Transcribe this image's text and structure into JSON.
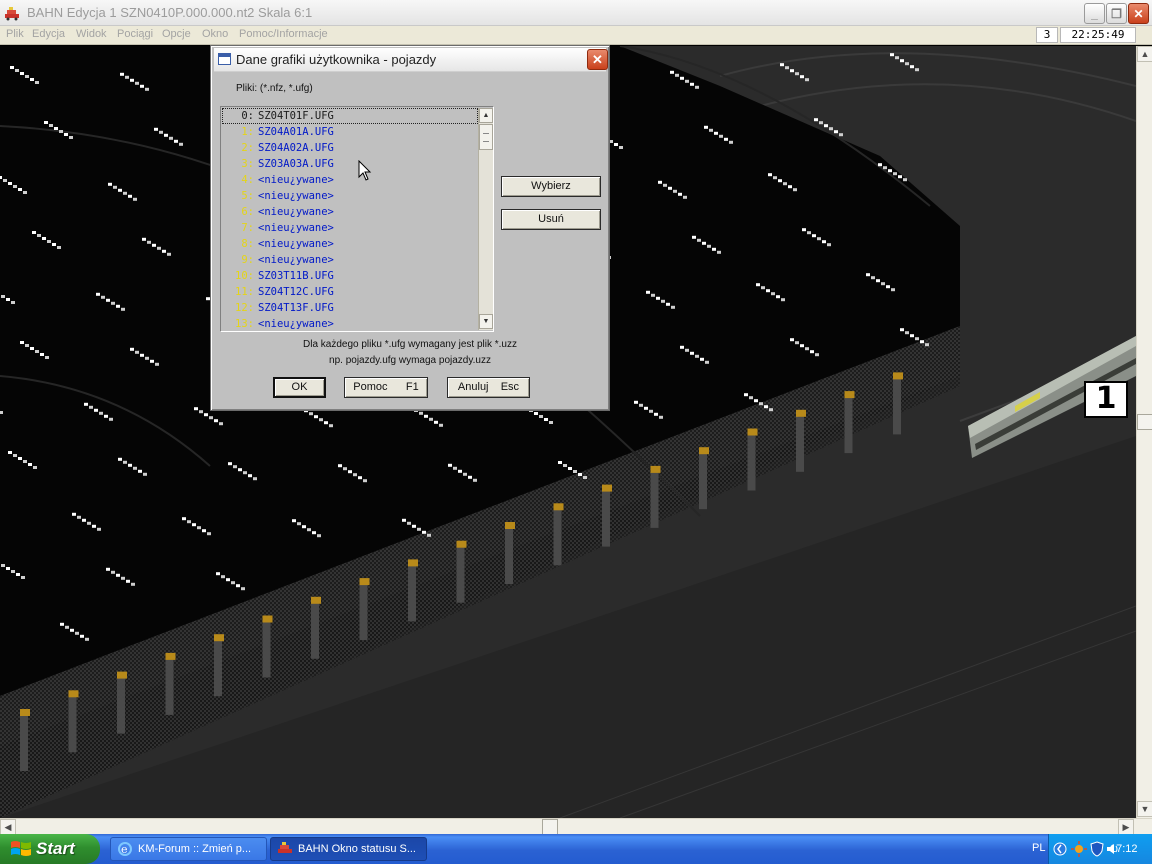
{
  "window": {
    "title": "BAHN Edycja 1 SZN0410P.000.000.nt2 Skala 6:1",
    "minimize_glyph": "_",
    "maximize_glyph": "❐",
    "close_glyph": "✕"
  },
  "menu": {
    "items": [
      "Plik",
      "Edycja",
      "Widok",
      "Pociągi",
      "Opcje",
      "Okno",
      "Pomoc/Informacje"
    ]
  },
  "status": {
    "count": "3",
    "time": "22:25:49"
  },
  "dialog": {
    "title": "Dane grafiki użytkownika - pojazdy",
    "close_glyph": "✕",
    "files_label": "Pliki: (*.nfz, *.ufg)",
    "rows": [
      {
        "index": "0:",
        "name": "SZ04T01F.UFG"
      },
      {
        "index": "1:",
        "name": "SZ04A01A.UFG"
      },
      {
        "index": "2:",
        "name": "SZ04A02A.UFG"
      },
      {
        "index": "3:",
        "name": "SZ03A03A.UFG"
      },
      {
        "index": "4:",
        "name": "<nieu¿ywane>"
      },
      {
        "index": "5:",
        "name": "<nieu¿ywane>"
      },
      {
        "index": "6:",
        "name": "<nieu¿ywane>"
      },
      {
        "index": "7:",
        "name": "<nieu¿ywane>"
      },
      {
        "index": "8:",
        "name": "<nieu¿ywane>"
      },
      {
        "index": "9:",
        "name": "<nieu¿ywane>"
      },
      {
        "index": "10:",
        "name": "SZ03T11B.UFG"
      },
      {
        "index": "11:",
        "name": "SZ04T12C.UFG"
      },
      {
        "index": "12:",
        "name": "SZ04T13F.UFG"
      },
      {
        "index": "13:",
        "name": "<nieu¿ywane>"
      }
    ],
    "selected_index": 0,
    "buttons": {
      "select": "Wybierz",
      "remove": "Usuń",
      "ok": "OK",
      "help": "Pomoc      F1",
      "cancel": "Anuluj    Esc"
    },
    "note_line1": "Dla każdego pliku *.ufg wymagany jest plik *.uzz",
    "note_line2": "np. pojazdy.ufg wymaga pojazdy.uzz"
  },
  "scene": {
    "train_number": "1"
  },
  "taskbar": {
    "start_label": "Start",
    "tasks": [
      {
        "label": "KM-Forum :: Zmień p...",
        "icon": "ie-icon"
      },
      {
        "label": "BAHN Okno statusu S...",
        "icon": "bahn-icon"
      }
    ],
    "language": "PL",
    "time": "17:12"
  },
  "colors": {
    "list_index": "#e4d418",
    "list_name": "#0018c8",
    "dialog_bg": "#c0c0c0",
    "taskbar_blue": "#245cd0",
    "start_green": "#2f8e2e"
  }
}
